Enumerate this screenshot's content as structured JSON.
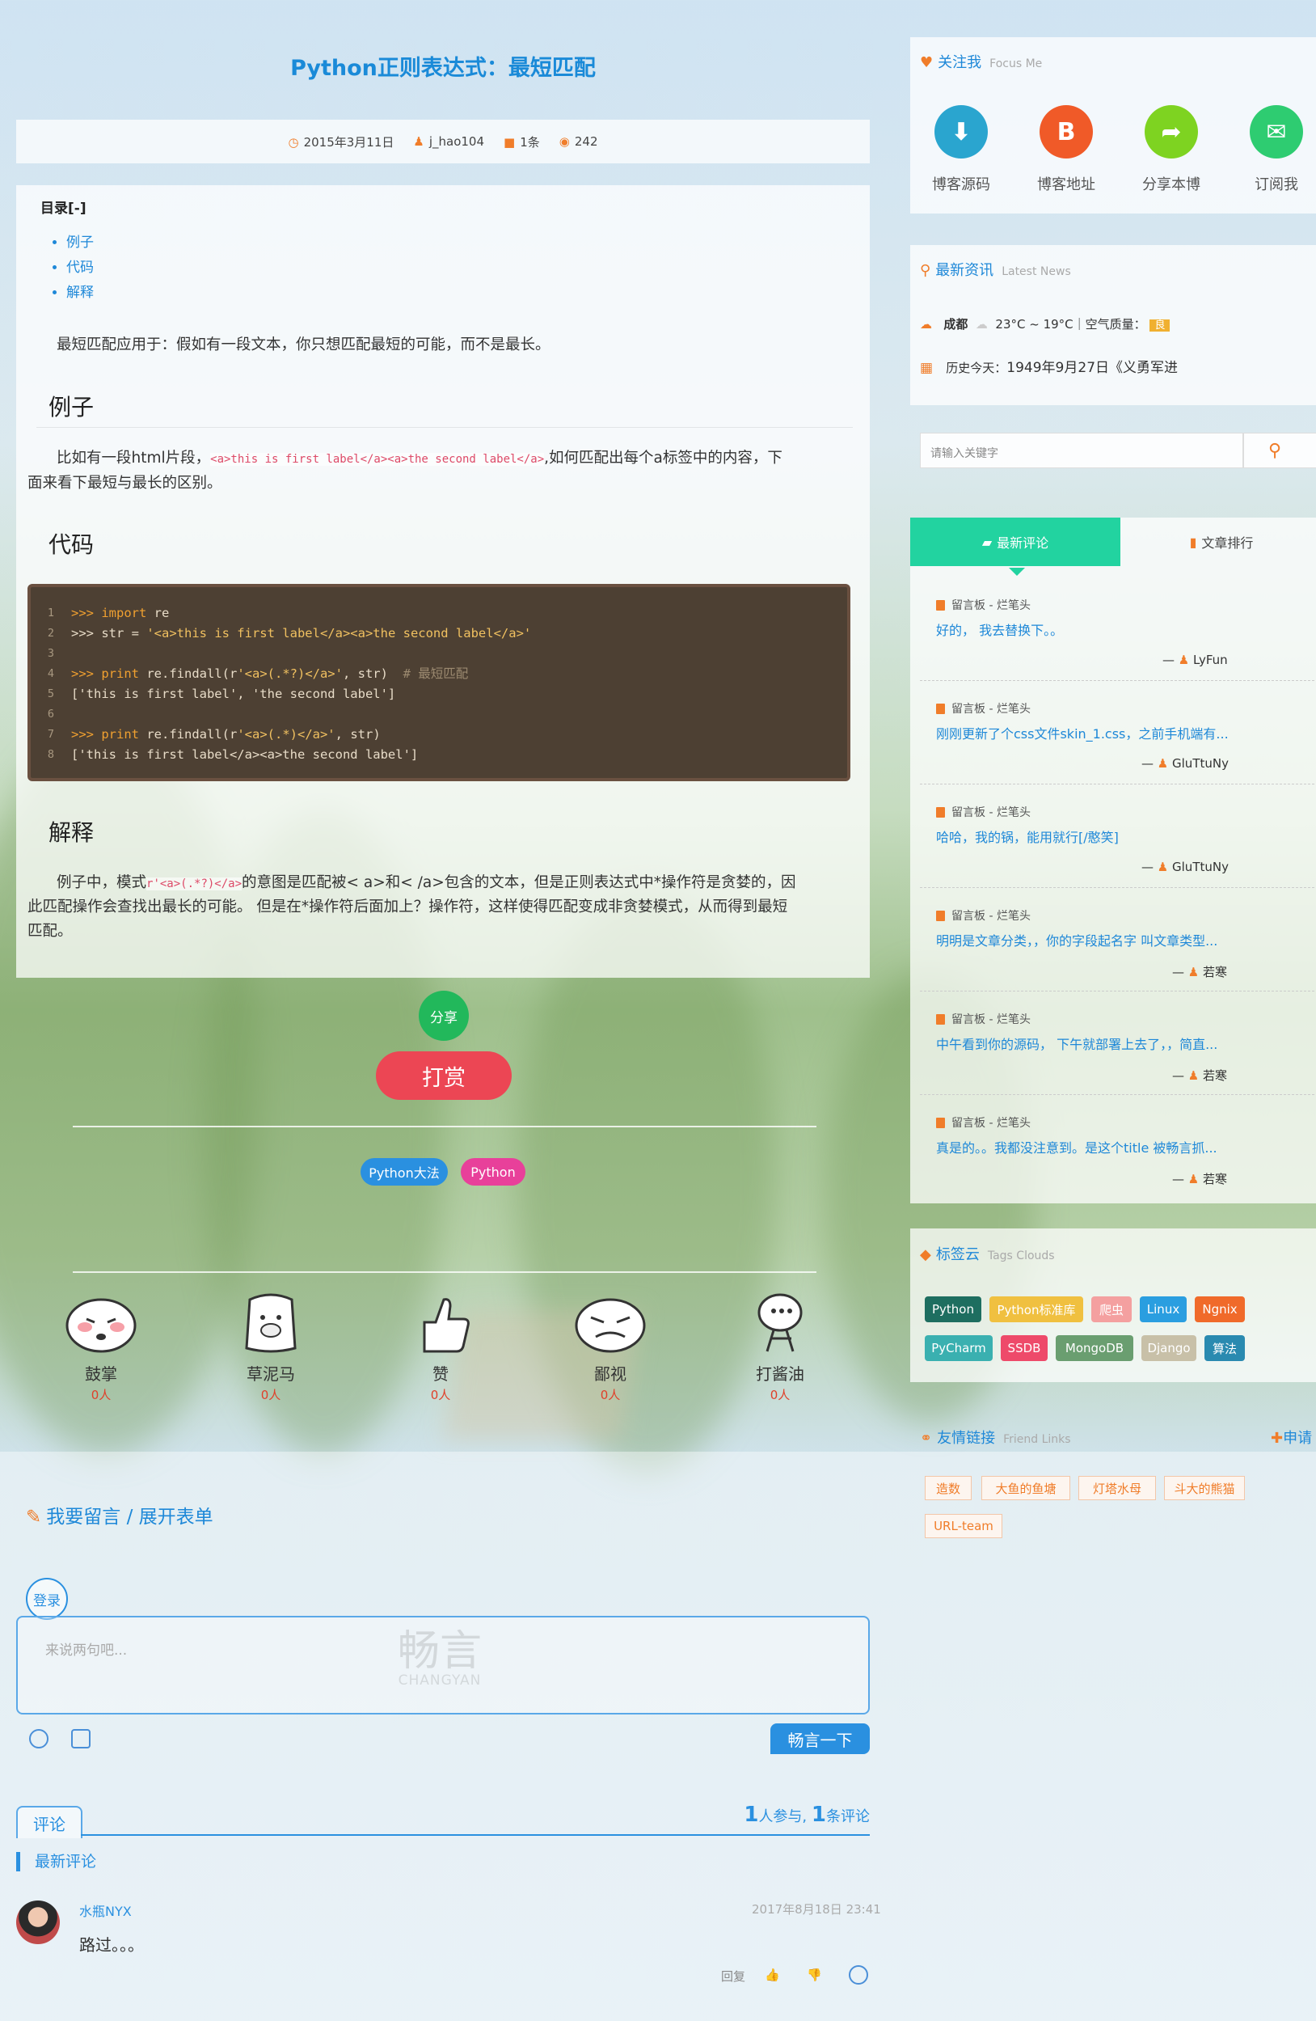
{
  "article": {
    "title": "Python正则表达式：最短匹配",
    "meta": {
      "date": "2015年3月11日",
      "author": "j_hao104",
      "comments": "1条",
      "views": "242"
    },
    "toc_title": "目录[-]",
    "toc_items": [
      "例子",
      "代码",
      "解释"
    ],
    "intro": "最短匹配应用于：假如有一段文本，你只想匹配最短的可能，而不是最长。",
    "section1_title": "例子",
    "s1_pre": "比如有一段html片段，",
    "s1_code": "<a>this is first label</a><a>the second label</a>",
    "s1_post": ",如何匹配出每个a标签中的内容，下",
    "s1_line2": "面来看下最短与最长的区别。",
    "section2_title": "代码",
    "code": {
      "line_numbers": [
        "1",
        "2",
        "3",
        "4",
        "5",
        "6",
        "7",
        "8"
      ],
      "l1a": ">>> ",
      "l1k": "import",
      "l1b": " re",
      "l2a": ">>> str = ",
      "l2s": "'<a>this is first label</a><a>the second label</a>'",
      "l4a": ">>> ",
      "l4k": "print",
      "l4b": " re.findall(r",
      "l4s": "'<a>(.*?)</a>'",
      "l4c": ", str)  ",
      "l4m": "# 最短匹配",
      "l5": "['this is first label', 'the second label']",
      "l7a": ">>> ",
      "l7k": "print",
      "l7b": " re.findall(r",
      "l7s": "'<a>(.*)</a>'",
      "l7c": ", str)",
      "l8": "['this is first label</a><a>the second label']"
    },
    "section3_title": "解释",
    "s3_pre": "例子中，模式",
    "s3_code": "r'<a>(.*?)</a>",
    "s3_post": "的意图是匹配被< a>和< /a>包含的文本，但是正则表达式中*操作符是贪婪的，因",
    "s3_line2": "此匹配操作会查找出最长的可能。 但是在*操作符后面加上？操作符，这样使得匹配变成非贪婪模式，从而得到最短",
    "s3_line3": "匹配。",
    "share_label": "分享",
    "reward_label": "打赏",
    "tags": [
      "Python大法",
      "Python"
    ]
  },
  "emotions": [
    {
      "label": "鼓掌",
      "count": "0人"
    },
    {
      "label": "草泥马",
      "count": "0人"
    },
    {
      "label": "赞",
      "count": "0人"
    },
    {
      "label": "鄙视",
      "count": "0人"
    },
    {
      "label": "打酱油",
      "count": "0人"
    }
  ],
  "comments": {
    "header": "我要留言 / 展开表单",
    "login": "登录",
    "placeholder": "来说两句吧...",
    "watermark": "畅言",
    "watermark_sub": "CHANGYAN",
    "submit": "畅言一下",
    "tab": "评论",
    "participants": "1",
    "participants_label": "人参与,",
    "count": "1",
    "count_label": "条评论",
    "latest_label": "最新评论",
    "item": {
      "user": "水瓶NYX",
      "date": "2017年8月18日 23:41",
      "text": "路过。。。",
      "reply": "回复"
    }
  },
  "sidebar": {
    "focus": {
      "title": "关注我",
      "subtitle": "Focus Me",
      "items": [
        {
          "label": "博客源码",
          "color": "#2aa5cf",
          "icon": "download-icon"
        },
        {
          "label": "博客地址",
          "color": "#f05a28",
          "icon": "blogger-icon"
        },
        {
          "label": "分享本博",
          "color": "#7ed321",
          "icon": "share-icon"
        },
        {
          "label": "订阅我",
          "color": "#2ecc71",
          "icon": "mail-icon"
        }
      ]
    },
    "news": {
      "title": "最新资讯",
      "subtitle": "Latest News",
      "city": "成都",
      "weather": "23°C ~ 19°C｜空气质量：",
      "aqi": "良",
      "history_label": "历史今天：",
      "history_text": "1949年9月27日《义勇军进"
    },
    "search": {
      "placeholder": "请输入关键字"
    },
    "tabs": {
      "active": "最新评论",
      "inactive": "文章排行"
    },
    "recent_comments": [
      {
        "source": "留言板 - 烂笔头",
        "content": "好的， 我去替换下。。",
        "author": "LyFun"
      },
      {
        "source": "留言板 - 烂笔头",
        "content": "刚刚更新了个css文件skin_1.css，之前手机端有...",
        "author": "GluTtuNy"
      },
      {
        "source": "留言板 - 烂笔头",
        "content": "哈哈，我的锅，能用就行[/憨笑]",
        "author": "GluTtuNy"
      },
      {
        "source": "留言板 - 烂笔头",
        "content": "明明是文章分类，，你的字段起名字 叫文章类型...",
        "author": "若寒"
      },
      {
        "source": "留言板 - 烂笔头",
        "content": "中午看到你的源码， 下午就部署上去了，，简直...",
        "author": "若寒"
      },
      {
        "source": "留言板 - 烂笔头",
        "content": "真是的。。我都没注意到。是这个title 被畅言抓...",
        "author": "若寒"
      }
    ],
    "tag_cloud": {
      "title": "标签云",
      "subtitle": "Tags Clouds",
      "tags": [
        {
          "label": "Python",
          "color": "#1e6e60"
        },
        {
          "label": "Python标准库",
          "color": "#f0c040"
        },
        {
          "label": "爬虫",
          "color": "#f4a0a0"
        },
        {
          "label": "Linux",
          "color": "#2a9ee0"
        },
        {
          "label": "Ngnix",
          "color": "#f06a2a"
        },
        {
          "label": "PyCharm",
          "color": "#3ab0b0"
        },
        {
          "label": "SSDB",
          "color": "#ee4a6a"
        },
        {
          "label": "MongoDB",
          "color": "#6a9e70"
        },
        {
          "label": "Django",
          "color": "#c8c0a8"
        },
        {
          "label": "算法",
          "color": "#2a8ab0"
        }
      ]
    },
    "links": {
      "title": "友情链接",
      "subtitle": "Friend Links",
      "apply": "申请",
      "items": [
        "造数",
        "大鱼的鱼塘",
        "灯塔水母",
        "斗大的熊猫",
        "URL-team"
      ]
    }
  }
}
